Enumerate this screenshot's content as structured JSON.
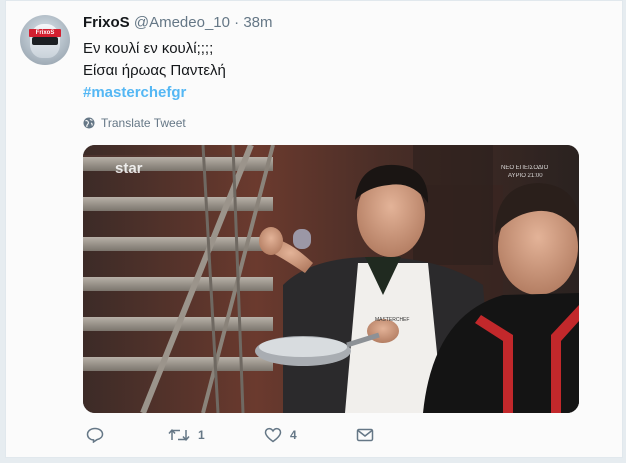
{
  "tweet": {
    "display_name": "FrixoS",
    "handle": "@Amedeo_10",
    "separator": "·",
    "time": "38m",
    "lines": [
      "Εν κουλί εν κουλί;;;;",
      "Είσαι ήρωας Παντελή"
    ],
    "hashtag": "#masterchefgr",
    "translate_label": "Translate Tweet"
  },
  "avatar": {
    "brand_text": "FrixoS"
  },
  "media": {
    "channel_logo": "star",
    "promo_line1": "ΝΕΟ ΕΠΕΙΣΟΔΙΟ",
    "promo_line2": "ΑΥΡΙΟ 21:00",
    "apron_text": "MASTERCHEF"
  },
  "actions": {
    "reply_icon": "reply-icon",
    "retweet_icon": "retweet-icon",
    "retweet_count": "1",
    "like_icon": "heart-icon",
    "like_count": "4",
    "dm_icon": "envelope-icon"
  },
  "colors": {
    "link": "#1da1f2",
    "muted": "#657786",
    "text": "#14171a"
  }
}
